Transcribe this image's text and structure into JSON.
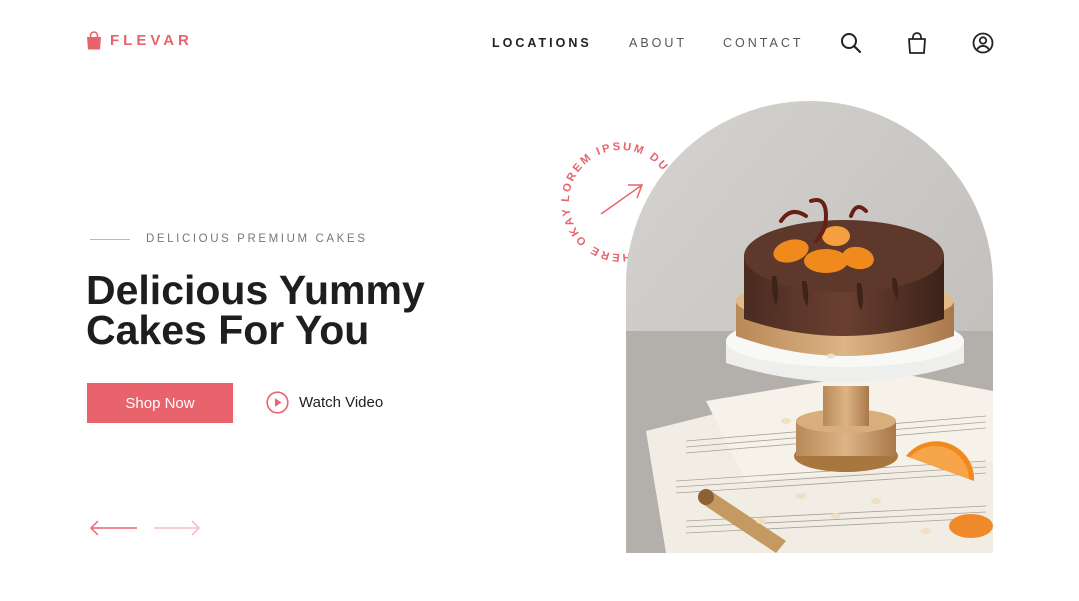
{
  "brand": {
    "name": "FLEVAR",
    "color": "#e8636c"
  },
  "nav": {
    "locations": "LOCATIONS",
    "about": "ABOUT",
    "contact": "CONTACT"
  },
  "icons": {
    "search": "search-icon",
    "cart": "shopping-bag-icon",
    "account": "user-icon"
  },
  "hero": {
    "eyebrow": "DELICIOUS PREMIUM CAKES",
    "title_line1": "Delicious Yummy",
    "title_line2": "Cakes For You",
    "cta_label": "Shop Now",
    "video_label": "Watch Video",
    "stamp_text": "LOREM IPSUM DUMMY TEXT IS HERE OKAY"
  },
  "colors": {
    "accent": "#e8636c",
    "text": "#1e1e1e",
    "muted": "#777777"
  }
}
